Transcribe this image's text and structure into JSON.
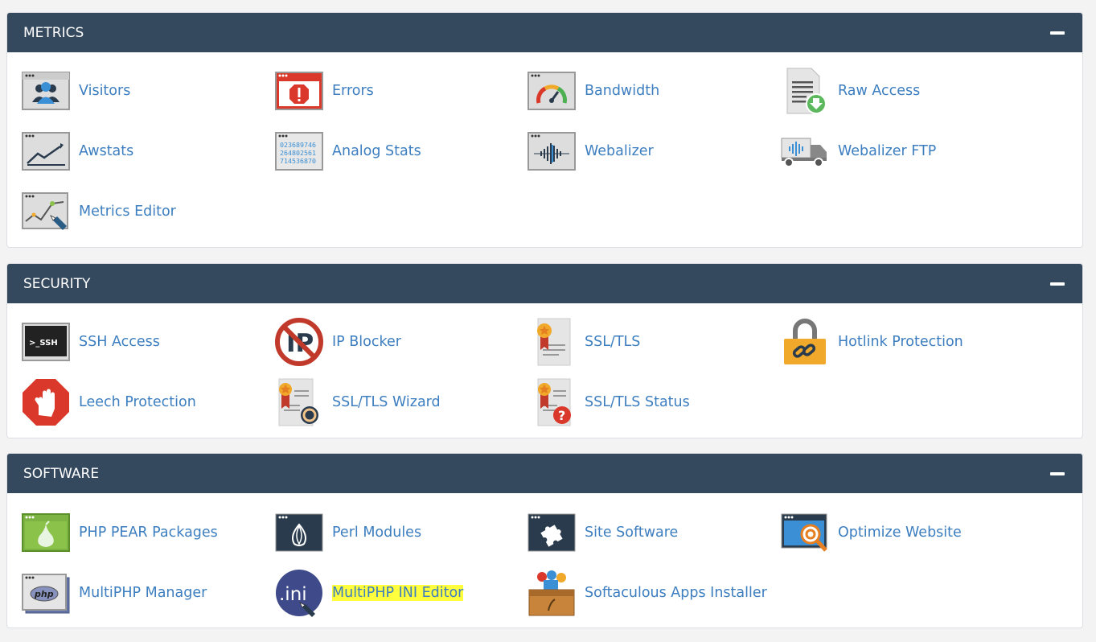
{
  "metrics": {
    "title": "METRICS",
    "items": [
      {
        "label": "Visitors",
        "icon": "visitors-icon"
      },
      {
        "label": "Errors",
        "icon": "errors-icon"
      },
      {
        "label": "Bandwidth",
        "icon": "bandwidth-icon"
      },
      {
        "label": "Raw Access",
        "icon": "raw-access-icon"
      },
      {
        "label": "Awstats",
        "icon": "awstats-icon"
      },
      {
        "label": "Analog Stats",
        "icon": "analog-stats-icon",
        "icon_text": [
          "023689746",
          "264802561",
          "714536870"
        ]
      },
      {
        "label": "Webalizer",
        "icon": "webalizer-icon"
      },
      {
        "label": "Webalizer FTP",
        "icon": "webalizer-ftp-icon"
      },
      {
        "label": "Metrics Editor",
        "icon": "metrics-editor-icon"
      }
    ]
  },
  "security": {
    "title": "SECURITY",
    "items": [
      {
        "label": "SSH Access",
        "icon": "ssh-icon",
        "icon_text": ">_SSH"
      },
      {
        "label": "IP Blocker",
        "icon": "ip-blocker-icon",
        "icon_text": "IP"
      },
      {
        "label": "SSL/TLS",
        "icon": "certificate-icon"
      },
      {
        "label": "Hotlink Protection",
        "icon": "padlock-chain-icon"
      },
      {
        "label": "Leech Protection",
        "icon": "stop-hand-icon"
      },
      {
        "label": "SSL/TLS Wizard",
        "icon": "certificate-wizard-icon"
      },
      {
        "label": "SSL/TLS Status",
        "icon": "certificate-status-icon",
        "icon_text": "?"
      }
    ]
  },
  "software": {
    "title": "SOFTWARE",
    "items": [
      {
        "label": "PHP PEAR Packages",
        "icon": "pear-icon"
      },
      {
        "label": "Perl Modules",
        "icon": "onion-icon"
      },
      {
        "label": "Site Software",
        "icon": "puzzle-icon"
      },
      {
        "label": "Optimize Website",
        "icon": "magnifier-gear-icon"
      },
      {
        "label": "MultiPHP Manager",
        "icon": "php-icon",
        "icon_text": "php"
      },
      {
        "label": "MultiPHP INI Editor",
        "icon": "ini-icon",
        "icon_text": ".ini",
        "highlighted": true
      },
      {
        "label": "Softaculous Apps Installer",
        "icon": "softaculous-icon"
      }
    ]
  },
  "colors": {
    "header_bg": "#34495e",
    "link": "#3c7ebf",
    "highlight": "#ffff3d"
  }
}
